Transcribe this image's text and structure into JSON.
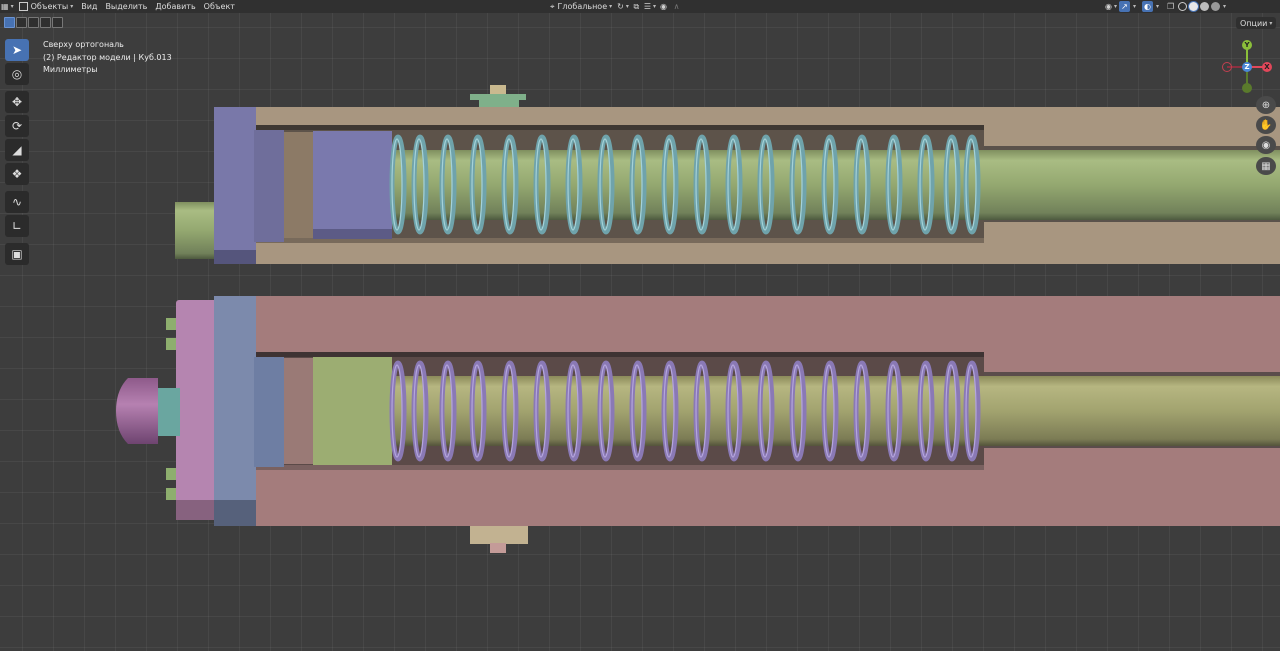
{
  "header": {
    "mode_label": "Объекты",
    "menu": [
      "Вид",
      "Выделить",
      "Добавить",
      "Объект"
    ],
    "orientation_label": "Глобальное",
    "icons": [
      "editor-type-icon",
      "mode-icon",
      "transform-orientation-icon",
      "pivot-icon",
      "snap-icon",
      "proportional-icon",
      "visibility-icon",
      "gizmo-icon",
      "overlay-icon",
      "xray-icon",
      "shading-wireframe-icon",
      "shading-solid-icon",
      "shading-material-icon",
      "shading-rendered-icon"
    ]
  },
  "viewport": {
    "options_label": "Опции",
    "info_lines": [
      "Сверху ортогональ",
      "(2) Редактор модели | Куб.013",
      "Миллиметры"
    ],
    "axes": {
      "y": "Y",
      "z": "Z",
      "x": "X"
    },
    "colors": {
      "x": "#e2475a",
      "y": "#8bbf3a",
      "z": "#4b88d6",
      "background": "#3d3d3d"
    }
  },
  "toolbar": {
    "tools": [
      "select-box",
      "cursor",
      "move",
      "rotate",
      "scale",
      "transform",
      "annotate",
      "measure",
      "add-cube"
    ],
    "active": "select-box"
  },
  "navigation": [
    "zoom-icon",
    "pan-icon",
    "camera-icon",
    "grid-toggle-icon"
  ]
}
